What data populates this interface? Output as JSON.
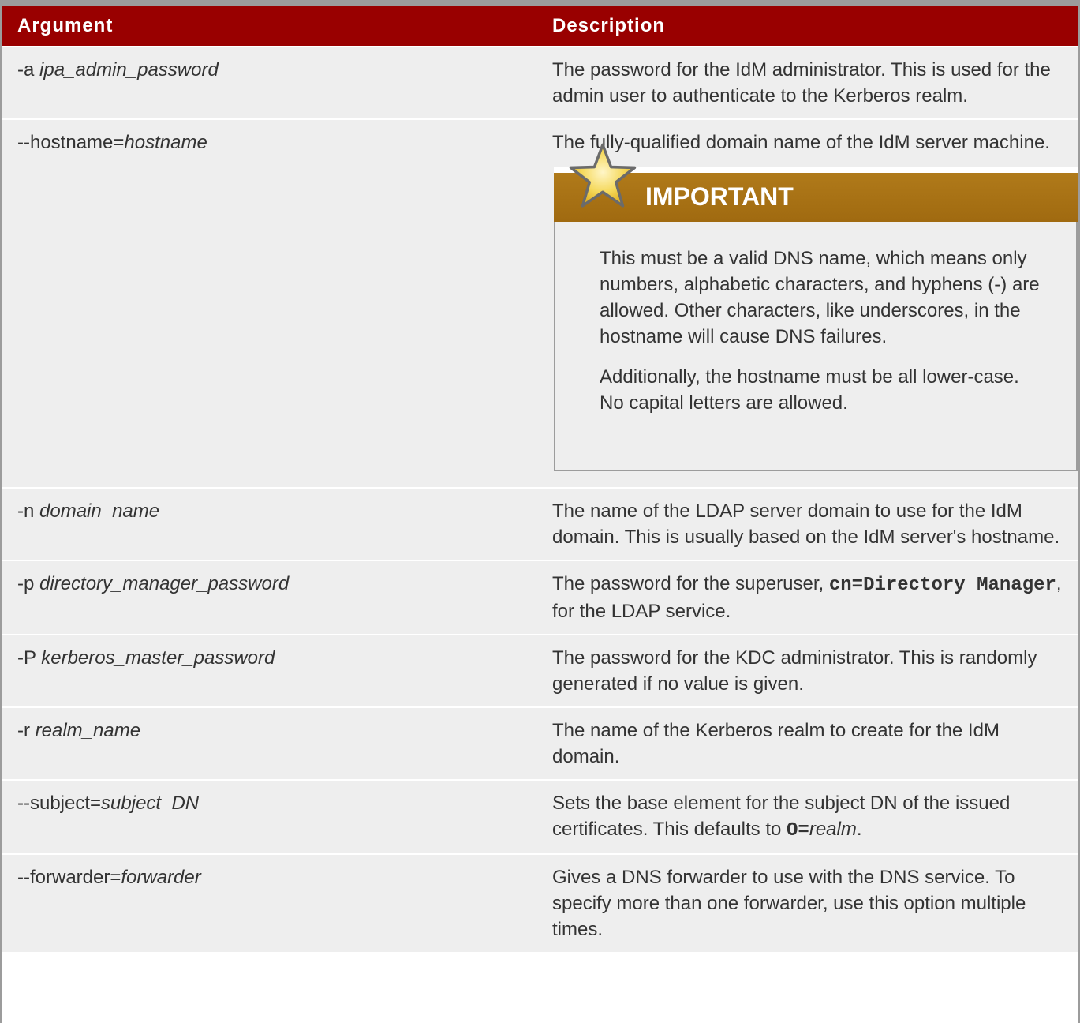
{
  "table": {
    "headers": {
      "argument": "Argument",
      "description": "Description"
    },
    "rows": [
      {
        "arg_prefix": "-a ",
        "arg_value": "ipa_admin_password",
        "desc": "The password for the IdM administrator. This is used for the admin user to authenticate to the Kerberos realm."
      },
      {
        "arg_prefix": "--hostname=",
        "arg_value": "hostname",
        "desc": "The fully-qualified domain name of the IdM server machine."
      },
      {
        "arg_prefix": "-n ",
        "arg_value": "domain_name",
        "desc": "The name of the LDAP server domain to use for the IdM domain. This is usually based on the IdM server's hostname."
      },
      {
        "arg_prefix": "-p ",
        "arg_value": "directory_manager_password",
        "desc_before": "The password for the superuser, ",
        "desc_code": "cn=Directory Manager",
        "desc_after": ", for the LDAP service."
      },
      {
        "arg_prefix": "-P ",
        "arg_value": "kerberos_master_password",
        "desc": "The password for the KDC administrator. This is randomly generated if no value is given."
      },
      {
        "arg_prefix": "-r ",
        "arg_value": "realm_name",
        "desc": "The name of the Kerberos realm to create for the IdM domain."
      },
      {
        "arg_prefix": "--subject=",
        "arg_value": "subject_DN",
        "desc_before": "Sets the base element for the subject DN of the issued certificates. This defaults to ",
        "desc_code": "O=",
        "desc_italic": "realm",
        "desc_after": "."
      },
      {
        "arg_prefix": "--forwarder=",
        "arg_value": "forwarder",
        "desc": "Gives a DNS forwarder to use with the DNS service. To specify more than one forwarder, use this option multiple times."
      }
    ]
  },
  "important": {
    "title": "IMPORTANT",
    "paragraphs": [
      "This must be a valid DNS name, which means only numbers, alphabetic characters, and hyphens (-) are allowed. Other characters, like underscores, in the hostname will cause DNS failures.",
      "Additionally, the hostname must be all lower-case. No capital letters are allowed."
    ],
    "icon": "star-icon"
  },
  "colors": {
    "header_bg": "#990000",
    "row_bg": "#eeeeee",
    "important_bar": "#a87214",
    "frame": "#9c9c9c"
  }
}
